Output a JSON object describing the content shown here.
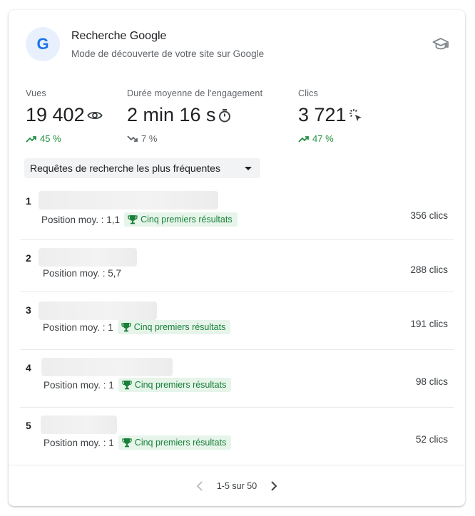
{
  "header": {
    "logo_letter": "G",
    "title": "Recherche Google",
    "subtitle": "Mode de découverte de votre site sur Google"
  },
  "metrics": [
    {
      "label": "Vues",
      "value": "19 402",
      "icon": "eye-icon",
      "change": "45 %",
      "trend": "up"
    },
    {
      "label": "Durée moyenne de l'engagement",
      "value": "2 min 16 s",
      "icon": "timer-icon",
      "change": "7 %",
      "trend": "down"
    },
    {
      "label": "Clics",
      "value": "3 721",
      "icon": "click-icon",
      "change": "47 %",
      "trend": "up"
    }
  ],
  "dropdown": {
    "label": "Requêtes de recherche les plus fréquentes"
  },
  "queries": [
    {
      "rank": "1",
      "position": "Position moy. : 1,1",
      "badge": "Cinq premiers résultats",
      "clics": "356 clics"
    },
    {
      "rank": "2",
      "position": "Position moy. : 5,7",
      "badge": "",
      "clics": "288 clics"
    },
    {
      "rank": "3",
      "position": "Position moy. : 1",
      "badge": "Cinq premiers résultats",
      "clics": "191 clics"
    },
    {
      "rank": "4",
      "position": "Position moy. : 1",
      "badge": "Cinq premiers résultats",
      "clics": "98 clics"
    },
    {
      "rank": "5",
      "position": "Position moy. : 1",
      "badge": "Cinq premiers résultats",
      "clics": "52 clics"
    }
  ],
  "pagination": {
    "text": "1-5 sur 50"
  },
  "colors": {
    "accent": "#1a73e8",
    "positive": "#1e8e3e",
    "badge_bg": "#e6f4ea"
  }
}
